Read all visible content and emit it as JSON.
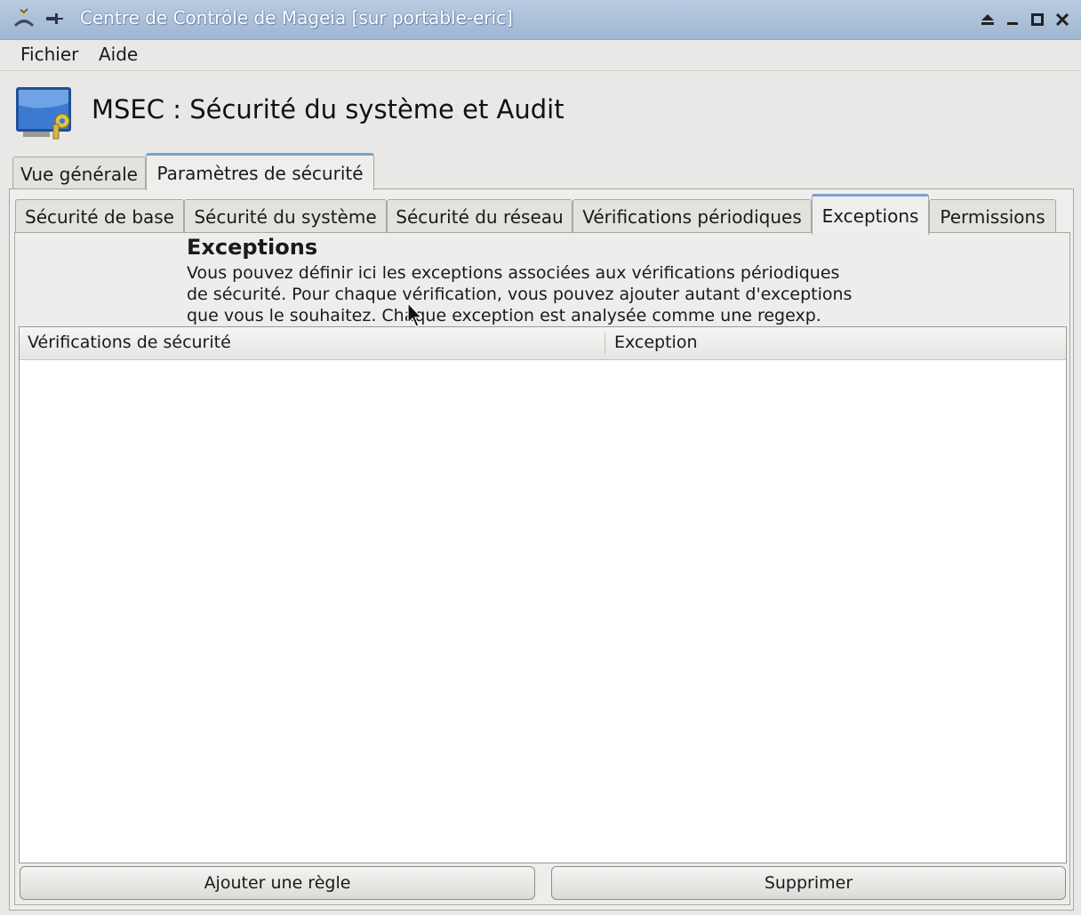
{
  "window": {
    "title": "Centre de Contrôle de Mageia  [sur portable-eric]",
    "controls": [
      "eject-icon",
      "minimize-icon",
      "maximize-icon",
      "close-icon"
    ]
  },
  "menubar": {
    "items": [
      {
        "label": "Fichier"
      },
      {
        "label": "Aide"
      }
    ]
  },
  "header": {
    "icon": "security-monitor-icon",
    "title": "MSEC : Sécurité du système et Audit"
  },
  "main_tabs": [
    {
      "label": "Vue générale",
      "active": false
    },
    {
      "label": "Paramètres de sécurité",
      "active": true
    }
  ],
  "sub_tabs": [
    {
      "label": "Sécurité de base",
      "active": false
    },
    {
      "label": "Sécurité du système",
      "active": false
    },
    {
      "label": "Sécurité du réseau",
      "active": false
    },
    {
      "label": "Vérifications périodiques",
      "active": false
    },
    {
      "label": "Exceptions",
      "active": true
    },
    {
      "label": "Permissions",
      "active": false
    }
  ],
  "section": {
    "title": "Exceptions",
    "description": [
      "Vous pouvez définir ici les exceptions associées aux vérifications périodiques",
      "de sécurité. Pour chaque vérification, vous pouvez ajouter autant d'exceptions",
      "que vous le souhaitez. Chaque exception est analysée comme une regexp."
    ]
  },
  "table": {
    "columns": [
      "Vérifications de sécurité",
      "Exception"
    ],
    "rows": []
  },
  "buttons": {
    "add_rule": "Ajouter une règle",
    "delete": "Supprimer"
  },
  "colors": {
    "titlebar": "#a9bed8",
    "active_tab_accent": "#7b9fd0",
    "window_bg": "#e9e8e6"
  }
}
